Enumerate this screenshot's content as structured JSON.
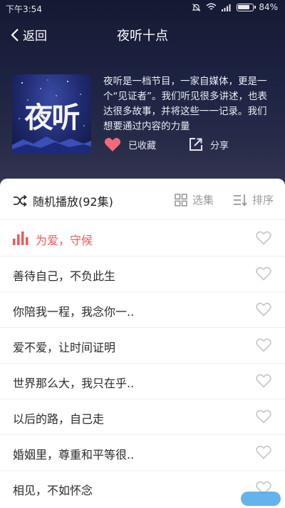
{
  "status": {
    "time": "下午3:54",
    "battery": "84%"
  },
  "nav": {
    "back_label": "返回",
    "title": "夜听十点"
  },
  "program": {
    "cover_title": "夜听",
    "description": "夜听是一档节目，一家自媒体，更是一个“见证者”。我们听见很多讲述，也表达很多故事，并将这些一一记录。我们想要通过内容的力量",
    "favorite_label": "已收藏",
    "share_label": "分享"
  },
  "toolbar": {
    "shuffle_label": "随机播放(92集)",
    "select_label": "选集",
    "sort_label": "排序"
  },
  "episodes": [
    {
      "title": "为爱，守候",
      "active": true
    },
    {
      "title": "善待自己，不负此生",
      "active": false
    },
    {
      "title": "你陪我一程，我念你一..",
      "active": false
    },
    {
      "title": "爱不爱，让时间证明",
      "active": false
    },
    {
      "title": "世界那么大，我只在乎..",
      "active": false
    },
    {
      "title": "以后的路，自己走",
      "active": false
    },
    {
      "title": "婚姻里，尊重和平等很..",
      "active": false
    },
    {
      "title": "相见，不如怀念",
      "active": false
    }
  ],
  "colors": {
    "accent": "#ea5a5a",
    "hero_bg": "#1d2342",
    "heart_filled": "#f06a7a"
  },
  "icons": [
    "back-chevron-icon",
    "heart-icon",
    "share-icon",
    "shuffle-icon",
    "grid-icon",
    "sort-icon",
    "playing-bars-icon"
  ]
}
